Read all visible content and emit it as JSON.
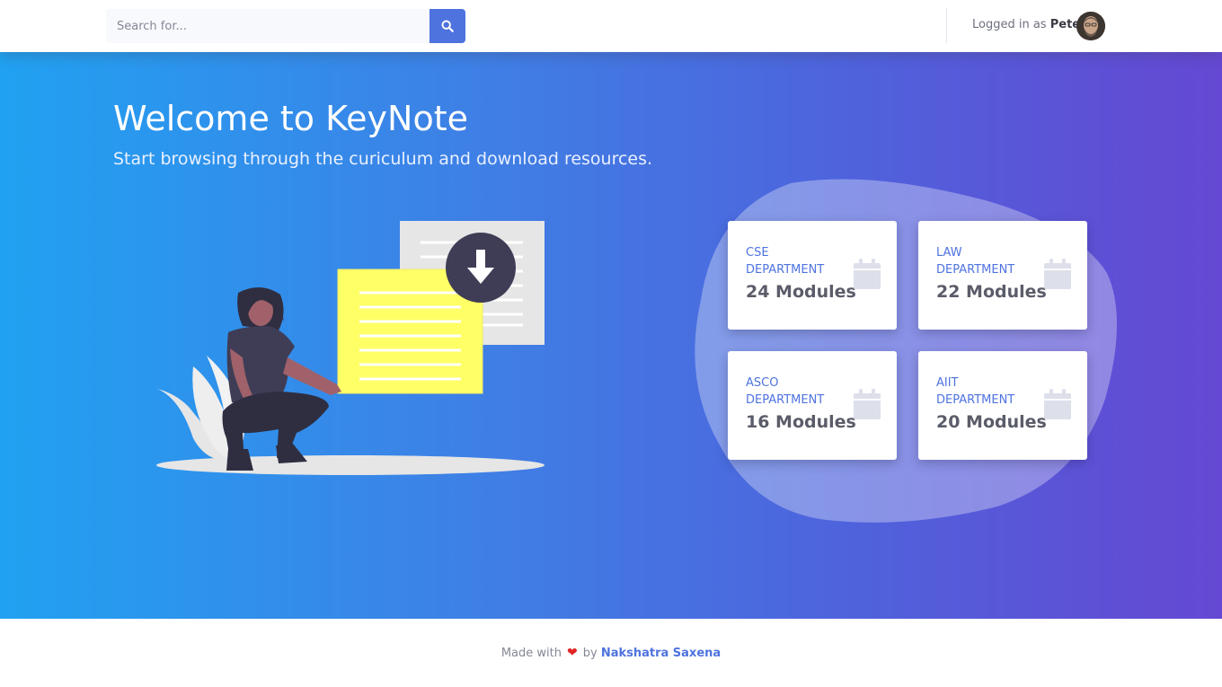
{
  "search": {
    "placeholder": "Search for..."
  },
  "user": {
    "prefix": "Logged in as",
    "name": "Peter"
  },
  "hero": {
    "title": "Welcome to KeyNote",
    "subtitle": "Start browsing through the curiculum and download resources."
  },
  "departments": [
    {
      "name_line1": "CSE",
      "name_line2": "DEPARTMENT",
      "modules": "24 Modules",
      "icon": "calendar-icon"
    },
    {
      "name_line1": "LAW",
      "name_line2": "DEPARTMENT",
      "modules": "22 Modules",
      "icon": "calendar-icon"
    },
    {
      "name_line1": "ASCO",
      "name_line2": "DEPARTMENT",
      "modules": "16 Modules",
      "icon": "calendar-icon"
    },
    {
      "name_line1": "AIIT",
      "name_line2": "DEPARTMENT",
      "modules": "20 Modules",
      "icon": "calendar-icon"
    }
  ],
  "footer": {
    "made_with": "Made with",
    "by": "by",
    "author": "Nakshatra Saxena"
  },
  "colors": {
    "accent": "#4e73df",
    "gradient_start": "#21a1f1",
    "gradient_end": "#6548d3",
    "heart": "#e02424"
  }
}
